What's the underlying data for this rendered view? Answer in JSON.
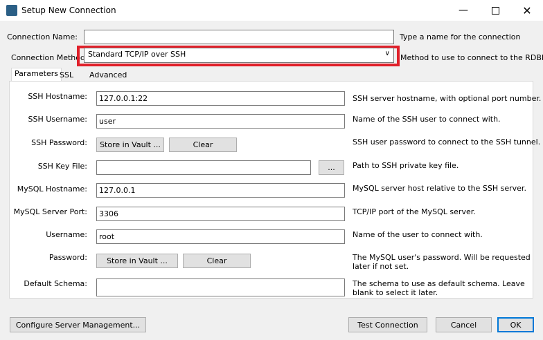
{
  "window": {
    "title": "Setup New Connection",
    "minimize_icon": "minimize-icon",
    "maximize_icon": "maximize-icon",
    "close_icon": "close-icon"
  },
  "connection_name": {
    "label": "Connection Name:",
    "value": "",
    "hint": "Type a name for the connection"
  },
  "connection_method": {
    "label": "Connection Method:",
    "value": "Standard TCP/IP over SSH",
    "hint": "Method to use to connect to the RDBMS",
    "highlight_color": "#e0202a"
  },
  "tabs": [
    {
      "label": "Parameters"
    },
    {
      "label": "SSL"
    },
    {
      "label": "Advanced"
    }
  ],
  "params": {
    "ssh_hostname": {
      "label": "SSH Hostname:",
      "value": "127.0.0.1:22",
      "desc": "SSH server hostname, with  optional port number."
    },
    "ssh_username": {
      "label": "SSH Username:",
      "value": "user",
      "desc": "Name of the SSH user to connect with."
    },
    "ssh_password": {
      "label": "SSH Password:",
      "store_label": "Store in Vault ...",
      "clear_label": "Clear",
      "desc": "SSH user password to connect to the SSH tunnel."
    },
    "ssh_keyfile": {
      "label": "SSH Key File:",
      "value": "",
      "browse_label": "...",
      "desc": "Path to SSH private key file."
    },
    "mysql_hostname": {
      "label": "MySQL Hostname:",
      "value": "127.0.0.1",
      "desc": "MySQL server host relative to the SSH server."
    },
    "mysql_port": {
      "label": "MySQL Server Port:",
      "value": "3306",
      "desc": "TCP/IP port of the MySQL server."
    },
    "username": {
      "label": "Username:",
      "value": "root",
      "desc": "Name of the user to connect with."
    },
    "password": {
      "label": "Password:",
      "store_label": "Store in Vault ...",
      "clear_label": "Clear",
      "desc_line1": "The MySQL user's password. Will be requested",
      "desc_line2": "later if not set."
    },
    "default_schema": {
      "label": "Default Schema:",
      "value": "",
      "desc_line1": "The schema to use as default schema. Leave",
      "desc_line2": "blank to select it later."
    }
  },
  "footer": {
    "configure_label": "Configure Server Management...",
    "test_label": "Test Connection",
    "cancel_label": "Cancel",
    "ok_label": "OK"
  }
}
